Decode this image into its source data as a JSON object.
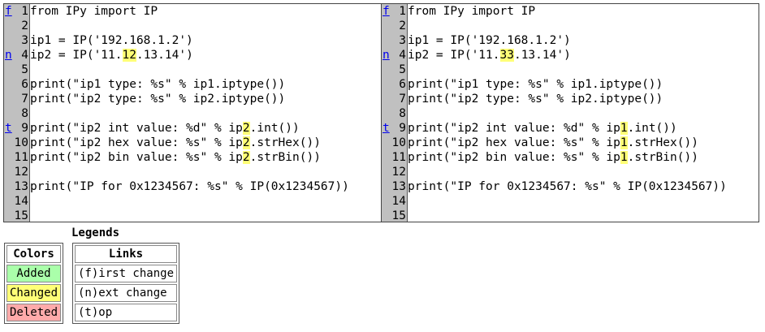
{
  "left": {
    "nav": [
      "f",
      "",
      "",
      "n",
      "",
      "",
      "",
      "",
      "t",
      "",
      "",
      "",
      "",
      "",
      ""
    ],
    "line_numbers": [
      "1",
      "2",
      "3",
      "4",
      "5",
      "6",
      "7",
      "8",
      "9",
      "10",
      "11",
      "12",
      "13",
      "14",
      "15"
    ],
    "lines": [
      [
        {
          "t": "from IPy import IP"
        }
      ],
      [],
      [
        {
          "t": "ip1 = IP('192.168.1.2')"
        }
      ],
      [
        {
          "t": "ip2 = IP('11."
        },
        {
          "t": "12",
          "c": true
        },
        {
          "t": ".13.14')"
        }
      ],
      [],
      [
        {
          "t": "print(\"ip1 type: %s\" % ip1.iptype())"
        }
      ],
      [
        {
          "t": "print(\"ip2 type: %s\" % ip2.iptype())"
        }
      ],
      [],
      [
        {
          "t": "print(\"ip2 int value: %d\" % ip"
        },
        {
          "t": "2",
          "c": true
        },
        {
          "t": ".int())"
        }
      ],
      [
        {
          "t": "print(\"ip2 hex value: %s\" % ip"
        },
        {
          "t": "2",
          "c": true
        },
        {
          "t": ".strHex())"
        }
      ],
      [
        {
          "t": "print(\"ip2 bin value: %s\" % ip"
        },
        {
          "t": "2",
          "c": true
        },
        {
          "t": ".strBin())"
        }
      ],
      [],
      [
        {
          "t": "print(\"IP for 0x1234567: %s\" % IP(0x1234567))"
        }
      ],
      [],
      []
    ]
  },
  "right": {
    "nav": [
      "f",
      "",
      "",
      "n",
      "",
      "",
      "",
      "",
      "t",
      "",
      "",
      "",
      "",
      "",
      ""
    ],
    "line_numbers": [
      "1",
      "2",
      "3",
      "4",
      "5",
      "6",
      "7",
      "8",
      "9",
      "10",
      "11",
      "12",
      "13",
      "14",
      "15"
    ],
    "lines": [
      [
        {
          "t": "from IPy import IP"
        }
      ],
      [],
      [
        {
          "t": "ip1 = IP('192.168.1.2')"
        }
      ],
      [
        {
          "t": "ip2 = IP('11."
        },
        {
          "t": "33",
          "c": true
        },
        {
          "t": ".13.14')"
        }
      ],
      [],
      [
        {
          "t": "print(\"ip1 type: %s\" % ip1.iptype())"
        }
      ],
      [
        {
          "t": "print(\"ip2 type: %s\" % ip2.iptype())"
        }
      ],
      [],
      [
        {
          "t": "print(\"ip2 int value: %d\" % ip"
        },
        {
          "t": "1",
          "c": true
        },
        {
          "t": ".int())"
        }
      ],
      [
        {
          "t": "print(\"ip2 hex value: %s\" % ip"
        },
        {
          "t": "1",
          "c": true
        },
        {
          "t": ".strHex())"
        }
      ],
      [
        {
          "t": "print(\"ip2 bin value: %s\" % ip"
        },
        {
          "t": "1",
          "c": true
        },
        {
          "t": ".strBin())"
        }
      ],
      [],
      [
        {
          "t": "print(\"IP for 0x1234567: %s\" % IP(0x1234567))"
        }
      ],
      [],
      []
    ]
  },
  "legend": {
    "title": "Legends",
    "colors_header": "Colors",
    "added": "Added",
    "changed": "Changed",
    "deleted": "Deleted",
    "links_header": "Links",
    "first_change": "(f)irst change",
    "next_change": "(n)ext change",
    "top": "(t)op"
  },
  "colors": {
    "added": "#aaffaa",
    "changed": "#ffff77",
    "deleted": "#ffaaaa",
    "gutter": "#c0c0c0"
  }
}
